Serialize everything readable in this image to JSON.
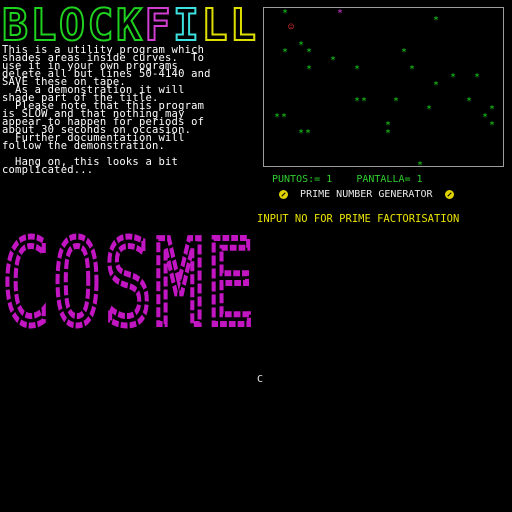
{
  "title": {
    "text": "BLOCKFILL",
    "colors": [
      "#1fd21f",
      "#1fd21f",
      "#1fd21f",
      "#1fd21f",
      "#1fd21f",
      "#d23dd2",
      "#3fe0e0",
      "#e0e000",
      "#e0e000"
    ]
  },
  "description": {
    "lines": [
      "This is a utility program which",
      "shades areas inside curves.  To",
      "use it in your own programs",
      "delete all but lines 50-4140 and",
      "SAVE these on tape.",
      "  As a demonstration it will",
      "shade part of the title.",
      "  Please note that this program",
      "is SLOW and that nothing may",
      "appear to happen for periods of",
      "about 30 seconds on occasion.",
      "  Further documentation will",
      "follow the demonstration.",
      "",
      "  Hang on, this looks a bit",
      "complicated..."
    ]
  },
  "game": {
    "hud": {
      "puntos_label": "PUNTOS:=",
      "puntos_value": "1",
      "pantalla_label": "PANTALLA=",
      "pantalla_value": "1"
    },
    "banner": "PRIME NUMBER GENERATOR",
    "star_glyph": "*",
    "player_glyph": "☺"
  },
  "prompt": {
    "text": "INPUT NO FOR PRIME FACTORISATION"
  },
  "big_word": {
    "text": "COSME",
    "color": "#c316c3"
  },
  "cursor": {
    "text": "C"
  },
  "colors": {
    "green": "#1fd21f",
    "magenta": "#d23dd2",
    "yellow": "#e0d200",
    "border": "#9c9c9c"
  }
}
